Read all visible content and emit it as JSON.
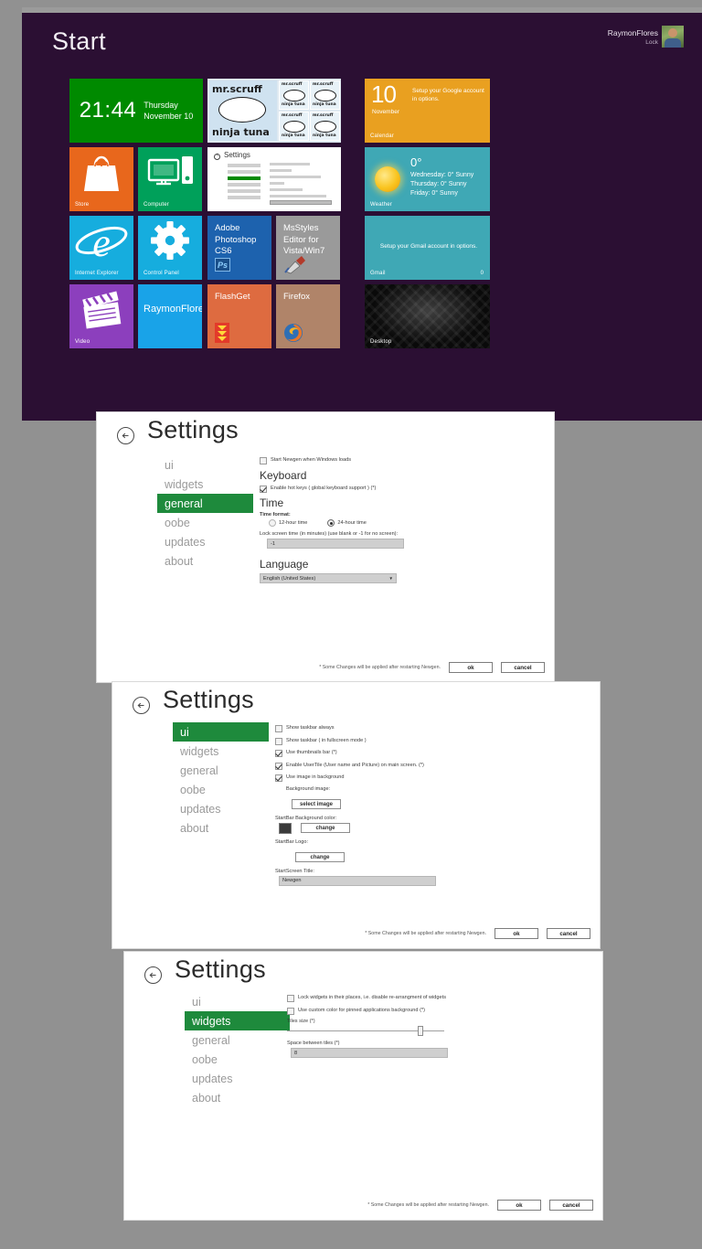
{
  "start": {
    "title": "Start",
    "user": {
      "name": "RaymonFlores",
      "lock_label": "Lock"
    },
    "tiles": {
      "clock": {
        "time": "21:44",
        "day": "Thursday",
        "date": "November 10"
      },
      "scruff": {
        "title": "mr.scruff",
        "subtitle": "ninja tuna"
      },
      "settings": {
        "label": "Settings"
      },
      "store": {
        "label": "Store"
      },
      "computer": {
        "label": "Computer"
      },
      "ie": {
        "label": "Internet Explorer"
      },
      "cpanel": {
        "label": "Control Panel"
      },
      "ps": {
        "label": "Adobe Photoshop CS6",
        "icon_text": "Ps"
      },
      "msstyles": {
        "label": "MsStyles Editor for Vista/Win7"
      },
      "video": {
        "label": "Video"
      },
      "raymon": {
        "label": "RaymonFlores"
      },
      "flashget": {
        "label": "FlashGet"
      },
      "firefox": {
        "label": "Firefox"
      },
      "calendar": {
        "day_number": "10",
        "month": "November",
        "label": "Calendar",
        "note": "Setup your Google account in options."
      },
      "weather": {
        "label": "Weather",
        "temp": "0°",
        "forecast": [
          "Wednesday: 0° Sunny",
          "Thursday: 0° Sunny",
          "Friday: 0° Sunny"
        ]
      },
      "gmail": {
        "label": "Gmail",
        "count": "0",
        "note": "Setup your Gmail account in options."
      },
      "desktop": {
        "label": "Desktop"
      }
    }
  },
  "common": {
    "dialog_title": "Settings",
    "nav": [
      "ui",
      "widgets",
      "general",
      "oobe",
      "updates",
      "about"
    ],
    "footer_note": "* Some Changes will be applied after restarting Newgen.",
    "ok_label": "ok",
    "cancel_label": "cancel"
  },
  "dialog_general": {
    "active_nav": "general",
    "startup_checkbox": {
      "label": "Start Newgen when Windows loads",
      "checked": false
    },
    "keyboard": {
      "heading": "Keyboard",
      "hotkeys": {
        "label": "Enable hot keys ( global keyboard support ) (*)",
        "checked": true
      }
    },
    "time": {
      "heading": "Time",
      "format_label": "Time format:",
      "option_12": "12-hour time",
      "option_24": "24-hour time",
      "selected_format": "24-hour time",
      "lock_screen_label": "Lock screen time (in minutes) (use blank or -1 for no screen):",
      "lock_screen_value": "-1"
    },
    "language": {
      "heading": "Language",
      "selected": "English (United States)"
    }
  },
  "dialog_ui": {
    "active_nav": "ui",
    "checkboxes": [
      {
        "label": "Show taskbar always",
        "checked": false
      },
      {
        "label": "Show taskbar ( in fullscreen mode )",
        "checked": false
      },
      {
        "label": "Use thumbnails bar (*)",
        "checked": true
      },
      {
        "label": "Enable UserTile (User name and Picture) on main screen. (*)",
        "checked": true
      },
      {
        "label": "Use image in background",
        "checked": true
      }
    ],
    "background_image": {
      "label": "Background image:",
      "button": "select image"
    },
    "startbar_color": {
      "label": "StartBar Background color:",
      "button": "change",
      "swatch": "#3a3a3a"
    },
    "startbar_logo": {
      "label": "StartBar Logo:",
      "button": "change"
    },
    "startscreen_title": {
      "label": "StartScreen Title:",
      "value": "Newgen"
    }
  },
  "dialog_widgets": {
    "active_nav": "widgets",
    "checkboxes": [
      {
        "label": "Lock widgets in their places, i.e. disable re-arrangment of widgets",
        "checked": false
      },
      {
        "label": "Use custom color for pinned applications background (*)",
        "checked": false
      }
    ],
    "tiles_size": {
      "label": "Tiles size (*)",
      "percent": 83
    },
    "space_between": {
      "label": "Space between tiles (*)",
      "value": "8"
    }
  }
}
